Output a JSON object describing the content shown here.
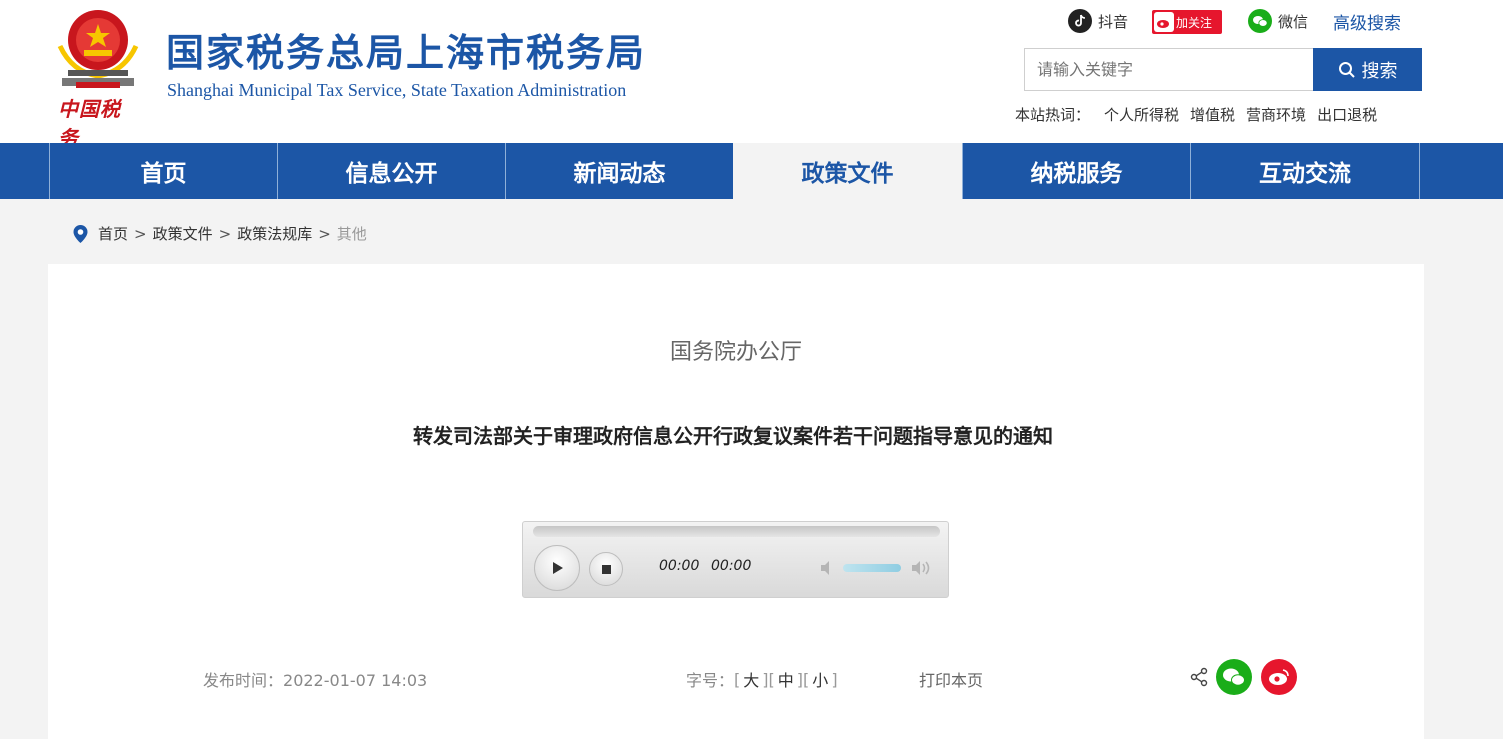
{
  "header": {
    "site_title": "国家税务总局上海市税务局",
    "site_subtitle": "Shanghai Municipal Tax Service, State Taxation Administration",
    "logo_text": "中国税务",
    "social": {
      "douyin": "抖音",
      "weibo": "加关注",
      "wechat": "微信"
    },
    "advanced_search": "高级搜索",
    "search": {
      "placeholder": "请输入关键字",
      "button": "搜索"
    },
    "hot_label": "本站热词：",
    "hot_words": [
      "个人所得税",
      "增值税",
      "营商环境",
      "出口退税"
    ]
  },
  "nav": {
    "items": [
      {
        "label": "首页"
      },
      {
        "label": "信息公开"
      },
      {
        "label": "新闻动态"
      },
      {
        "label": "政策文件",
        "active": true
      },
      {
        "label": "纳税服务"
      },
      {
        "label": "互动交流"
      }
    ]
  },
  "breadcrumb": {
    "items": [
      "首页",
      "政策文件",
      "政策法规库"
    ],
    "separator": ">",
    "current": "其他"
  },
  "article": {
    "issuer": "国务院办公厅",
    "title": "转发司法部关于审理政府信息公开行政复议案件若干问题指导意见的通知",
    "player": {
      "current_time": "00:00",
      "duration": "00:00",
      "volume": 1.0
    },
    "publish_label": "发布时间：",
    "publish_time": "2022-01-07 14:03",
    "font_size_label": "字号：",
    "font_sizes": [
      "大",
      "中",
      "小"
    ],
    "print": "打印本页"
  },
  "colors": {
    "brand_blue": "#1c56a6",
    "wechat_green": "#1aad19",
    "weibo_red": "#e6162d"
  }
}
